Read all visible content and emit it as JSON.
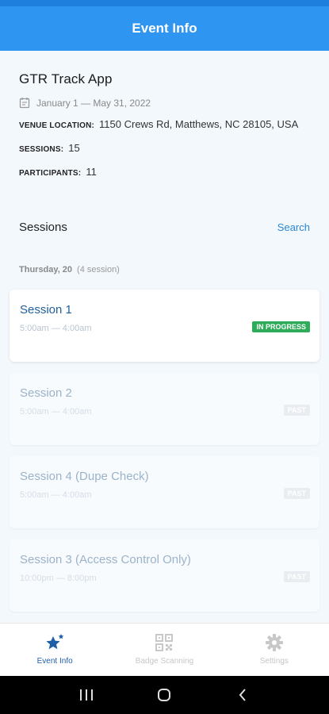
{
  "appbar": {
    "title": "Event Info"
  },
  "event": {
    "name": "GTR Track App",
    "dates": "January 1 — May 31, 2022",
    "venue_label": "VENUE LOCATION:",
    "venue_value": "1150 Crews Rd, Matthews, NC 28105, USA",
    "sessions_label": "SESSIONS:",
    "sessions_value": "15",
    "participants_label": "PARTICIPANTS:",
    "participants_value": "11"
  },
  "sessions_section": {
    "title": "Sessions",
    "search_label": "Search"
  },
  "day": {
    "label": "Thursday, 20",
    "count": "(4 session)"
  },
  "sessions": [
    {
      "title": "Session 1",
      "time": "5:00am — 4:00am",
      "status": "IN PROGRESS"
    },
    {
      "title": "Session 2",
      "time": "5:00am — 4:00am",
      "status": "PAST"
    },
    {
      "title": "Session 4 (Dupe Check)",
      "time": "5:00am — 4:00am",
      "status": "PAST"
    },
    {
      "title": "Session 3 (Access Control Only)",
      "time": "10:00pm — 8:00pm",
      "status": "PAST"
    }
  ],
  "bottom_nav": [
    {
      "label": "Event Info",
      "icon": "star-icon",
      "active": true
    },
    {
      "label": "Badge Scanning",
      "icon": "qr-code-icon",
      "active": false
    },
    {
      "label": "Settings",
      "icon": "gear-icon",
      "active": false
    }
  ],
  "colors": {
    "primary": "#2e95f1",
    "in_progress": "#2eac5a",
    "nav_active": "#1f5fa8"
  }
}
